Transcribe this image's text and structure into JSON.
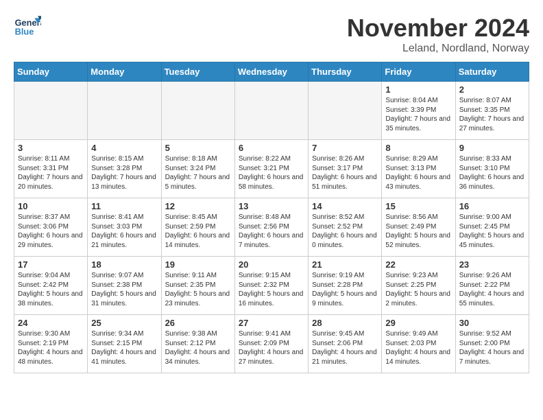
{
  "logo": {
    "line1": "General",
    "line2": "Blue"
  },
  "title": "November 2024",
  "subtitle": "Leland, Nordland, Norway",
  "days_of_week": [
    "Sunday",
    "Monday",
    "Tuesday",
    "Wednesday",
    "Thursday",
    "Friday",
    "Saturday"
  ],
  "weeks": [
    [
      {
        "day": null
      },
      {
        "day": null
      },
      {
        "day": null
      },
      {
        "day": null
      },
      {
        "day": null
      },
      {
        "day": "1",
        "sunrise": "Sunrise: 8:04 AM",
        "sunset": "Sunset: 3:39 PM",
        "daylight": "Daylight: 7 hours and 35 minutes."
      },
      {
        "day": "2",
        "sunrise": "Sunrise: 8:07 AM",
        "sunset": "Sunset: 3:35 PM",
        "daylight": "Daylight: 7 hours and 27 minutes."
      }
    ],
    [
      {
        "day": "3",
        "sunrise": "Sunrise: 8:11 AM",
        "sunset": "Sunset: 3:31 PM",
        "daylight": "Daylight: 7 hours and 20 minutes."
      },
      {
        "day": "4",
        "sunrise": "Sunrise: 8:15 AM",
        "sunset": "Sunset: 3:28 PM",
        "daylight": "Daylight: 7 hours and 13 minutes."
      },
      {
        "day": "5",
        "sunrise": "Sunrise: 8:18 AM",
        "sunset": "Sunset: 3:24 PM",
        "daylight": "Daylight: 7 hours and 5 minutes."
      },
      {
        "day": "6",
        "sunrise": "Sunrise: 8:22 AM",
        "sunset": "Sunset: 3:21 PM",
        "daylight": "Daylight: 6 hours and 58 minutes."
      },
      {
        "day": "7",
        "sunrise": "Sunrise: 8:26 AM",
        "sunset": "Sunset: 3:17 PM",
        "daylight": "Daylight: 6 hours and 51 minutes."
      },
      {
        "day": "8",
        "sunrise": "Sunrise: 8:29 AM",
        "sunset": "Sunset: 3:13 PM",
        "daylight": "Daylight: 6 hours and 43 minutes."
      },
      {
        "day": "9",
        "sunrise": "Sunrise: 8:33 AM",
        "sunset": "Sunset: 3:10 PM",
        "daylight": "Daylight: 6 hours and 36 minutes."
      }
    ],
    [
      {
        "day": "10",
        "sunrise": "Sunrise: 8:37 AM",
        "sunset": "Sunset: 3:06 PM",
        "daylight": "Daylight: 6 hours and 29 minutes."
      },
      {
        "day": "11",
        "sunrise": "Sunrise: 8:41 AM",
        "sunset": "Sunset: 3:03 PM",
        "daylight": "Daylight: 6 hours and 21 minutes."
      },
      {
        "day": "12",
        "sunrise": "Sunrise: 8:45 AM",
        "sunset": "Sunset: 2:59 PM",
        "daylight": "Daylight: 6 hours and 14 minutes."
      },
      {
        "day": "13",
        "sunrise": "Sunrise: 8:48 AM",
        "sunset": "Sunset: 2:56 PM",
        "daylight": "Daylight: 6 hours and 7 minutes."
      },
      {
        "day": "14",
        "sunrise": "Sunrise: 8:52 AM",
        "sunset": "Sunset: 2:52 PM",
        "daylight": "Daylight: 6 hours and 0 minutes."
      },
      {
        "day": "15",
        "sunrise": "Sunrise: 8:56 AM",
        "sunset": "Sunset: 2:49 PM",
        "daylight": "Daylight: 5 hours and 52 minutes."
      },
      {
        "day": "16",
        "sunrise": "Sunrise: 9:00 AM",
        "sunset": "Sunset: 2:45 PM",
        "daylight": "Daylight: 5 hours and 45 minutes."
      }
    ],
    [
      {
        "day": "17",
        "sunrise": "Sunrise: 9:04 AM",
        "sunset": "Sunset: 2:42 PM",
        "daylight": "Daylight: 5 hours and 38 minutes."
      },
      {
        "day": "18",
        "sunrise": "Sunrise: 9:07 AM",
        "sunset": "Sunset: 2:38 PM",
        "daylight": "Daylight: 5 hours and 31 minutes."
      },
      {
        "day": "19",
        "sunrise": "Sunrise: 9:11 AM",
        "sunset": "Sunset: 2:35 PM",
        "daylight": "Daylight: 5 hours and 23 minutes."
      },
      {
        "day": "20",
        "sunrise": "Sunrise: 9:15 AM",
        "sunset": "Sunset: 2:32 PM",
        "daylight": "Daylight: 5 hours and 16 minutes."
      },
      {
        "day": "21",
        "sunrise": "Sunrise: 9:19 AM",
        "sunset": "Sunset: 2:28 PM",
        "daylight": "Daylight: 5 hours and 9 minutes."
      },
      {
        "day": "22",
        "sunrise": "Sunrise: 9:23 AM",
        "sunset": "Sunset: 2:25 PM",
        "daylight": "Daylight: 5 hours and 2 minutes."
      },
      {
        "day": "23",
        "sunrise": "Sunrise: 9:26 AM",
        "sunset": "Sunset: 2:22 PM",
        "daylight": "Daylight: 4 hours and 55 minutes."
      }
    ],
    [
      {
        "day": "24",
        "sunrise": "Sunrise: 9:30 AM",
        "sunset": "Sunset: 2:19 PM",
        "daylight": "Daylight: 4 hours and 48 minutes."
      },
      {
        "day": "25",
        "sunrise": "Sunrise: 9:34 AM",
        "sunset": "Sunset: 2:15 PM",
        "daylight": "Daylight: 4 hours and 41 minutes."
      },
      {
        "day": "26",
        "sunrise": "Sunrise: 9:38 AM",
        "sunset": "Sunset: 2:12 PM",
        "daylight": "Daylight: 4 hours and 34 minutes."
      },
      {
        "day": "27",
        "sunrise": "Sunrise: 9:41 AM",
        "sunset": "Sunset: 2:09 PM",
        "daylight": "Daylight: 4 hours and 27 minutes."
      },
      {
        "day": "28",
        "sunrise": "Sunrise: 9:45 AM",
        "sunset": "Sunset: 2:06 PM",
        "daylight": "Daylight: 4 hours and 21 minutes."
      },
      {
        "day": "29",
        "sunrise": "Sunrise: 9:49 AM",
        "sunset": "Sunset: 2:03 PM",
        "daylight": "Daylight: 4 hours and 14 minutes."
      },
      {
        "day": "30",
        "sunrise": "Sunrise: 9:52 AM",
        "sunset": "Sunset: 2:00 PM",
        "daylight": "Daylight: 4 hours and 7 minutes."
      }
    ]
  ]
}
